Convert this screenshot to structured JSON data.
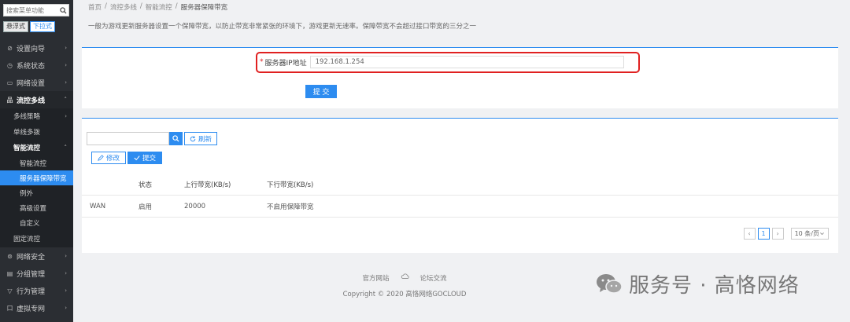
{
  "sidebar": {
    "search_placeholder": "搜索菜单功能",
    "mode_float": "悬浮式",
    "mode_dropdown": "下拉式",
    "items": [
      {
        "icon": "compass-icon",
        "glyph": "⊘",
        "label": "设置向导",
        "arrow": "›"
      },
      {
        "icon": "clock-icon",
        "glyph": "◷",
        "label": "系统状态",
        "arrow": "›"
      },
      {
        "icon": "monitor-icon",
        "glyph": "▭",
        "label": "网络设置",
        "arrow": "›"
      },
      {
        "icon": "network-icon",
        "glyph": "品",
        "label": "流控多线",
        "arrow": "˄"
      }
    ],
    "sub_items": [
      {
        "label": "多线策略",
        "arrow": "›"
      },
      {
        "label": "单线多拨",
        "arrow": ""
      },
      {
        "label": "智能流控",
        "arrow": "˄"
      }
    ],
    "sub2_items": [
      "智能流控",
      "服务器保障带宽",
      "例外",
      "高级设置",
      "自定义"
    ],
    "fixed_flow": "固定流控",
    "bottom_items": [
      {
        "icon": "shield-icon",
        "glyph": "⊚",
        "label": "网络安全",
        "arrow": "›"
      },
      {
        "icon": "group-icon",
        "glyph": "▤",
        "label": "分组管理",
        "arrow": "›"
      },
      {
        "icon": "filter-icon",
        "glyph": "▽",
        "label": "行为管理",
        "arrow": "›"
      },
      {
        "icon": "vpn-icon",
        "glyph": "口",
        "label": "虚拟专网",
        "arrow": "›"
      }
    ]
  },
  "breadcrumb": [
    "首页",
    "流控多线",
    "智能流控",
    "服务器保障带宽"
  ],
  "breadcrumb_sep": "/",
  "description": "一般为游戏更新服务器设置一个保障带宽，以防止带宽非常紧张的环境下，游戏更新无速率。保障带宽不会超过接口带宽的三分之一",
  "form": {
    "required_mark": "*",
    "ip_label": "服务器IP地址",
    "ip_value": "192.168.1.254",
    "submit_label": "提 交"
  },
  "toolbar": {
    "search_value": "",
    "refresh_label": "刷新",
    "edit_label": "修改",
    "submit_label": "提交"
  },
  "table": {
    "headers": [
      "",
      "状态",
      "上行带宽(KB/s)",
      "下行带宽(KB/s)"
    ],
    "rows": [
      [
        "WAN",
        "启用",
        "20000",
        "不启用保障带宽"
      ]
    ]
  },
  "pager": {
    "prev": "‹",
    "current": "1",
    "next": "›",
    "page_size": "10 条/页"
  },
  "footer": {
    "link_official": "官方网站",
    "link_forum": "论坛交流",
    "copyright": "Copyright © 2020 高恪网络GOCLOUD"
  },
  "watermark": "服务号 · 高恪网络",
  "colors": {
    "accent": "#2d8cf0",
    "highlight": "#e02020",
    "sidebar": "#2b2e33"
  }
}
